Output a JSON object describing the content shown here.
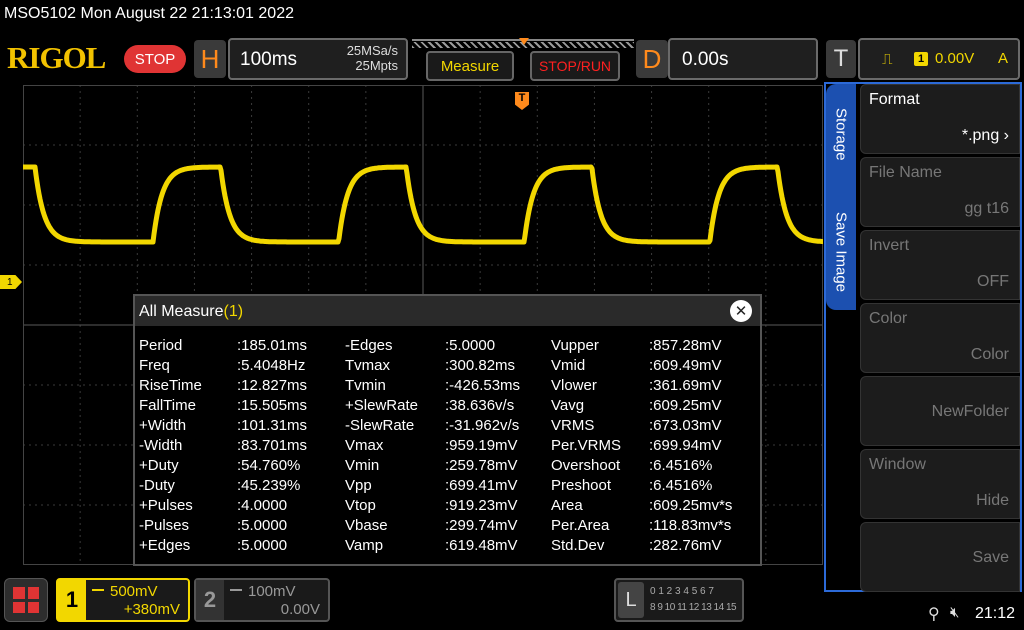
{
  "header": {
    "title": "MSO5102  Mon August 22 21:13:01 2022",
    "logo": "RIGOL",
    "status": "STOP"
  },
  "horizontal": {
    "letter": "H",
    "timebase": "100ms",
    "sample_rate": "25MSa/s",
    "memory_depth": "25Mpts"
  },
  "buttons": {
    "measure": "Measure",
    "stop_run": "STOP/RUN"
  },
  "delay": {
    "letter": "D",
    "value": "0.00s"
  },
  "trigger": {
    "letter": "T",
    "source": "1",
    "level": "0.00V",
    "mode": "A",
    "position_marker": "T"
  },
  "channel1_marker": "1",
  "measure_panel": {
    "title": "All Measure",
    "channel": "(1)",
    "close": "✕",
    "rows": [
      [
        "Period",
        ":185.01ms",
        "-Edges",
        ":5.0000",
        "Vupper",
        ":857.28mV"
      ],
      [
        "Freq",
        ":5.4048Hz",
        "Tvmax",
        ":300.82ms",
        "Vmid",
        ":609.49mV"
      ],
      [
        "RiseTime",
        ":12.827ms",
        "Tvmin",
        ":-426.53ms",
        "Vlower",
        ":361.69mV"
      ],
      [
        "FallTime",
        ":15.505ms",
        "+SlewRate",
        ":38.636v/s",
        "Vavg",
        ":609.25mV"
      ],
      [
        "+Width",
        ":101.31ms",
        "-SlewRate",
        ":-31.962v/s",
        "VRMS",
        ":673.03mV"
      ],
      [
        "-Width",
        ":83.701ms",
        "Vmax",
        ":959.19mV",
        "Per.VRMS",
        ":699.94mV"
      ],
      [
        "+Duty",
        ":54.760%",
        "Vmin",
        ":259.78mV",
        "Overshoot",
        ":6.4516%"
      ],
      [
        "-Duty",
        ":45.239%",
        "Vpp",
        ":699.41mV",
        "Preshoot",
        ":6.4516%"
      ],
      [
        "+Pulses",
        ":4.0000",
        "Vtop",
        ":919.23mV",
        "Area",
        ":609.25mv*s"
      ],
      [
        "-Pulses",
        ":5.0000",
        "Vbase",
        ":299.74mV",
        "Per.Area",
        ":118.83mv*s"
      ],
      [
        "+Edges",
        ":5.0000",
        "Vamp",
        ":619.48mV",
        "Std.Dev",
        ":282.76mV"
      ]
    ]
  },
  "side_tabs": {
    "storage": "Storage",
    "save_image": "Save Image"
  },
  "menu": {
    "format_label": "Format",
    "format_value": "*.png",
    "filename_label": "File Name",
    "filename_value": "gg t16",
    "invert_label": "Invert",
    "invert_value": "OFF",
    "color_label": "Color",
    "color_value": "Color",
    "newfolder_label": "NewFolder",
    "window_label": "Window",
    "window_value": "Hide",
    "save_label": "Save"
  },
  "channel1": {
    "number": "1",
    "scale": "500mV",
    "offset": "+380mV"
  },
  "channel2": {
    "number": "2",
    "scale": "100mV",
    "offset": "0.00V"
  },
  "logic_analyzer": {
    "letter": "L",
    "row1": "0 1 2 3   4 5 6 7",
    "row2": "8 9 10 11  12 13 14 15"
  },
  "status_bar": {
    "time": "21:12"
  },
  "colors": {
    "trace": "#f2d700",
    "accent": "#ff8a1c",
    "menu_blue": "#1c50b0",
    "stop_red": "#e03434"
  }
}
